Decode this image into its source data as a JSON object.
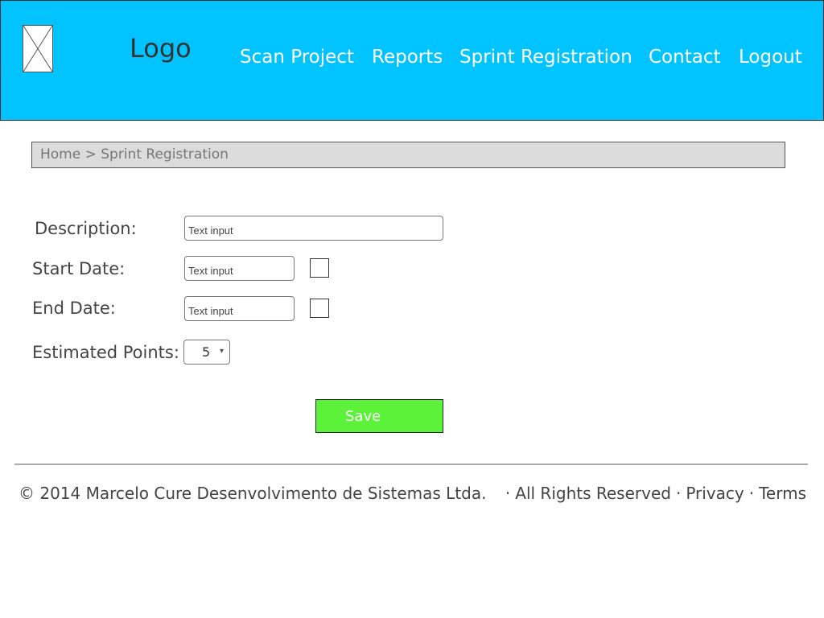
{
  "header": {
    "logo_text": "Logo",
    "nav": [
      {
        "label": "Scan Project"
      },
      {
        "label": "Reports"
      },
      {
        "label": "Sprint Registration"
      },
      {
        "label": "Contact"
      },
      {
        "label": "Logout"
      }
    ]
  },
  "breadcrumb": {
    "text": "Home > Sprint Registration"
  },
  "form": {
    "description_label": "Description:",
    "description_placeholder": "Text input",
    "start_date_label": "Start Date:",
    "start_date_placeholder": "Text input",
    "end_date_label": "End Date:",
    "end_date_placeholder": "Text input",
    "estimated_points_label": "Estimated Points:",
    "estimated_points_value": "5",
    "dropdown_arrow": "▾",
    "save_label": "Save"
  },
  "footer": {
    "copyright": "© 2014 Marcelo Cure Desenvolvimento de Sistemas Ltda.",
    "separator": "·",
    "rights": "All Rights Reserved",
    "privacy": "Privacy",
    "terms": "Terms"
  },
  "colors": {
    "header_bg": "#00c3ff",
    "save_button": "#5cf23a",
    "breadcrumb_bg": "#dcdcdc"
  },
  "icons": {
    "logo_placeholder": "image-placeholder-icon",
    "date_picker": "checkbox-icon",
    "dropdown": "chevron-down-icon"
  }
}
